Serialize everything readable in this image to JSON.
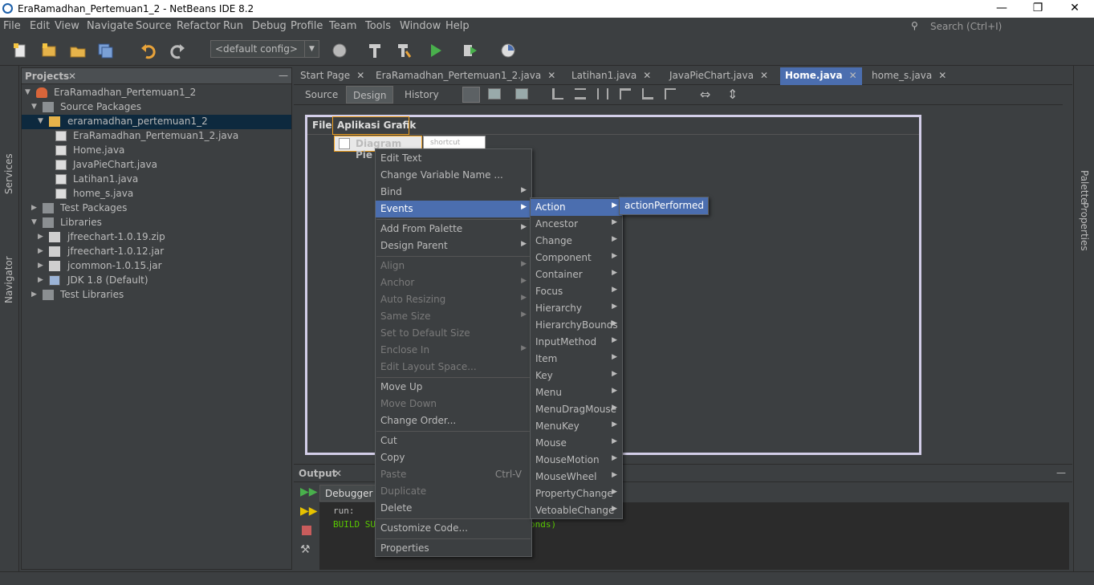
{
  "window": {
    "title": "EraRamadhan_Pertemuan1_2 - NetBeans IDE 8.2",
    "minimize": "—",
    "maximize": "❐",
    "close": "✕"
  },
  "menubar": {
    "items": [
      "File",
      "Edit",
      "View",
      "Navigate",
      "Source",
      "Refactor",
      "Run",
      "Debug",
      "Profile",
      "Team",
      "Tools",
      "Window",
      "Help"
    ],
    "search_placeholder": "Search (Ctrl+I)"
  },
  "toolbar": {
    "config": "<default config>"
  },
  "side_left": {
    "services": "Services",
    "navigator": "Navigator"
  },
  "side_right": {
    "palette": "Palette",
    "properties": "Properties"
  },
  "projects": {
    "title": "Projects",
    "close": "✕",
    "minimize": "—",
    "tree": [
      {
        "label": "EraRamadhan_Pertemuan1_2"
      },
      {
        "label": "Source Packages"
      },
      {
        "label": "eraramadhan_pertemuan1_2"
      },
      {
        "label": "EraRamadhan_Pertemuan1_2.java"
      },
      {
        "label": "Home.java"
      },
      {
        "label": "JavaPieChart.java"
      },
      {
        "label": "Latihan1.java"
      },
      {
        "label": "home_s.java"
      },
      {
        "label": "Test Packages"
      },
      {
        "label": "Libraries"
      },
      {
        "label": "jfreechart-1.0.19.zip"
      },
      {
        "label": "jfreechart-1.0.12.jar"
      },
      {
        "label": "jcommon-1.0.15.jar"
      },
      {
        "label": "JDK 1.8 (Default)"
      },
      {
        "label": "Test Libraries"
      }
    ]
  },
  "editor": {
    "tabs": [
      {
        "label": "Start Page"
      },
      {
        "label": "EraRamadhan_Pertemuan1_2.java"
      },
      {
        "label": "Latihan1.java"
      },
      {
        "label": "JavaPieChart.java"
      },
      {
        "label": "Home.java"
      },
      {
        "label": "home_s.java"
      }
    ],
    "tab_close": "✕",
    "view_tabs": [
      "Source",
      "Design",
      "History"
    ],
    "form": {
      "menu_file": "File",
      "menu_aplikasi": "Aplikasi Grafik",
      "item": "Diagram Pie",
      "shortcut": "shortcut"
    }
  },
  "context_menu": {
    "items": [
      {
        "label": "Edit Text"
      },
      {
        "label": "Change Variable Name ..."
      },
      {
        "label": "Bind"
      },
      {
        "label": "Events"
      },
      {
        "label": "Add From Palette"
      },
      {
        "label": "Design Parent"
      },
      {
        "label": "Align"
      },
      {
        "label": "Anchor"
      },
      {
        "label": "Auto Resizing"
      },
      {
        "label": "Same Size"
      },
      {
        "label": "Set to Default Size"
      },
      {
        "label": "Enclose In"
      },
      {
        "label": "Edit Layout Space..."
      },
      {
        "label": "Move Up"
      },
      {
        "label": "Move Down"
      },
      {
        "label": "Change Order..."
      },
      {
        "label": "Cut"
      },
      {
        "label": "Copy"
      },
      {
        "label": "Paste",
        "shortcut": "Ctrl-V"
      },
      {
        "label": "Duplicate"
      },
      {
        "label": "Delete"
      },
      {
        "label": "Customize Code..."
      },
      {
        "label": "Properties"
      }
    ]
  },
  "events_menu": {
    "items": [
      "Action",
      "Ancestor",
      "Change",
      "Component",
      "Container",
      "Focus",
      "Hierarchy",
      "HierarchyBounds",
      "InputMethod",
      "Item",
      "Key",
      "Menu",
      "MenuDragMouse",
      "MenuKey",
      "Mouse",
      "MouseMotion",
      "MouseWheel",
      "PropertyChange",
      "VetoableChange"
    ]
  },
  "action_menu": {
    "items": [
      "actionPerformed"
    ]
  },
  "output": {
    "title": "Output",
    "close": "✕",
    "minimize": "—",
    "debugger_tab": "Debugger Console",
    "line1": "run:",
    "line2": "BUILD SU",
    "line2_tail": "onds)"
  },
  "colors": {
    "accent": "#4b6eaf",
    "background": "#3c3f41",
    "selection_outline": "#f0a020",
    "build_text": "#59c800"
  }
}
